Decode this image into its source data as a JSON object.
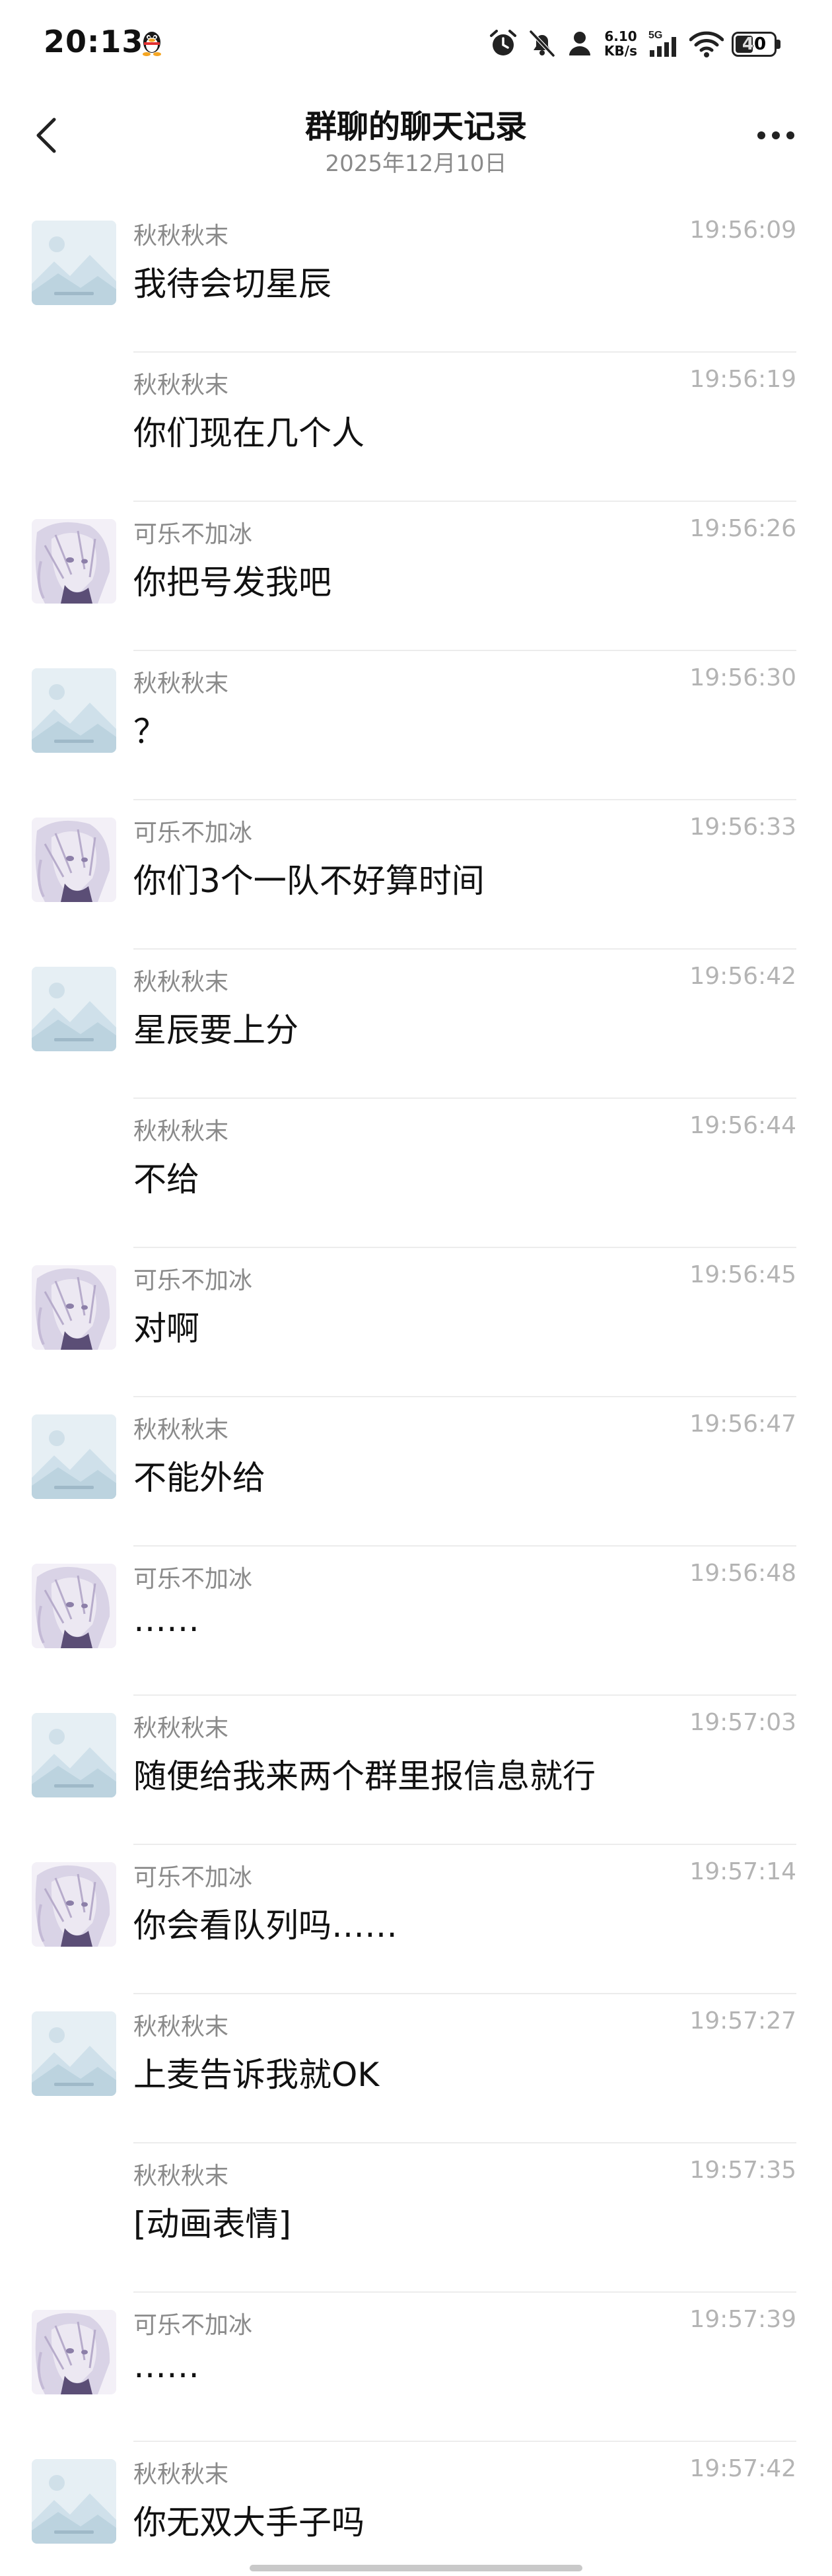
{
  "status_bar": {
    "time": "20:13",
    "net_speed_value": "6.10",
    "net_speed_unit": "KB/s",
    "network_type": "5G",
    "battery_level": "40"
  },
  "header": {
    "title": "群聊的聊天记录",
    "date": "2025年12月10日"
  },
  "messages": [
    {
      "sender": "秋秋秋末",
      "time": "19:56:09",
      "content": "我待会切星辰",
      "avatar": "placeholder-image"
    },
    {
      "sender": "秋秋秋末",
      "time": "19:56:19",
      "content": "你们现在几个人",
      "avatar": "none"
    },
    {
      "sender": "可乐不加冰",
      "time": "19:56:26",
      "content": "你把号发我吧",
      "avatar": "anime-girl"
    },
    {
      "sender": "秋秋秋末",
      "time": "19:56:30",
      "content": "？",
      "avatar": "placeholder-image"
    },
    {
      "sender": "可乐不加冰",
      "time": "19:56:33",
      "content": "你们3个一队不好算时间",
      "avatar": "anime-girl"
    },
    {
      "sender": "秋秋秋末",
      "time": "19:56:42",
      "content": "星辰要上分",
      "avatar": "placeholder-image"
    },
    {
      "sender": "秋秋秋末",
      "time": "19:56:44",
      "content": "不给",
      "avatar": "none"
    },
    {
      "sender": "可乐不加冰",
      "time": "19:56:45",
      "content": "对啊",
      "avatar": "anime-girl"
    },
    {
      "sender": "秋秋秋末",
      "time": "19:56:47",
      "content": "不能外给",
      "avatar": "placeholder-image"
    },
    {
      "sender": "可乐不加冰",
      "time": "19:56:48",
      "content": "……",
      "avatar": "anime-girl"
    },
    {
      "sender": "秋秋秋末",
      "time": "19:57:03",
      "content": "随便给我来两个群里报信息就行",
      "avatar": "placeholder-image"
    },
    {
      "sender": "可乐不加冰",
      "time": "19:57:14",
      "content": "你会看队列吗……",
      "avatar": "anime-girl"
    },
    {
      "sender": "秋秋秋末",
      "time": "19:57:27",
      "content": "上麦告诉我就OK",
      "avatar": "placeholder-image"
    },
    {
      "sender": "秋秋秋末",
      "time": "19:57:35",
      "content": "[动画表情]",
      "avatar": "none"
    },
    {
      "sender": "可乐不加冰",
      "time": "19:57:39",
      "content": "……",
      "avatar": "anime-girl"
    },
    {
      "sender": "秋秋秋末",
      "time": "19:57:42",
      "content": "你无双大手子吗",
      "avatar": "placeholder-image"
    }
  ]
}
